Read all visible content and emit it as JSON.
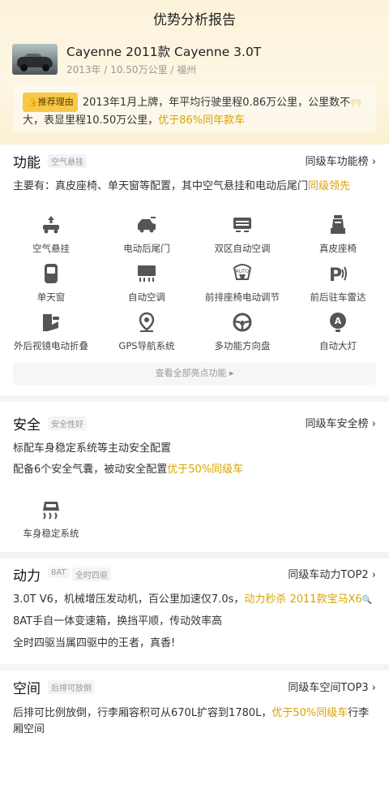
{
  "header": {
    "title": "优势分析报告",
    "car_name": "Cayenne 2011款 Cayenne 3.0T",
    "car_meta": "2013年 / 10.50万公里 / 福州",
    "reason_badge": "推荐理由",
    "reason_text_1": "2013年1月上牌，年平均行驶里程0.86万公里，公里数不大，表显里程10.50万公里，",
    "reason_highlight": "优于86%同年款车"
  },
  "function": {
    "title": "功能",
    "tag": "空气悬挂",
    "rank": "同级车功能榜",
    "desc_prefix": "主要有：真皮座椅、单天窗等配置，其中空气悬挂和电动后尾门",
    "desc_highlight": "同级领先",
    "features": [
      {
        "label": "空气悬挂",
        "icon": "air-suspension-icon"
      },
      {
        "label": "电动后尾门",
        "icon": "power-tailgate-icon"
      },
      {
        "label": "双区自动空调",
        "icon": "dual-zone-ac-icon"
      },
      {
        "label": "真皮座椅",
        "icon": "leather-seat-icon"
      },
      {
        "label": "单天窗",
        "icon": "sunroof-icon"
      },
      {
        "label": "自动空调",
        "icon": "auto-ac-icon"
      },
      {
        "label": "前排座椅电动调节",
        "icon": "power-seat-icon"
      },
      {
        "label": "前后驻车雷达",
        "icon": "parking-radar-icon"
      },
      {
        "label": "外后视镜电动折叠",
        "icon": "mirror-fold-icon"
      },
      {
        "label": "GPS导航系统",
        "icon": "gps-icon"
      },
      {
        "label": "多功能方向盘",
        "icon": "steering-wheel-icon"
      },
      {
        "label": "自动大灯",
        "icon": "auto-headlight-icon"
      }
    ],
    "more_label": "查看全部亮点功能 ▸"
  },
  "safety": {
    "title": "安全",
    "tag": "安全性好",
    "rank": "同级车安全榜",
    "line1": "标配车身稳定系统等主动安全配置",
    "line2_prefix": "配备6个安全气囊，被动安全配置",
    "line2_highlight": "优于50%同级车",
    "feature_label": "车身稳定系统",
    "feature_icon": "stability-control-icon"
  },
  "power": {
    "title": "动力",
    "tag1": "8AT",
    "tag2": "全时四驱",
    "rank": "同级车动力TOP2",
    "line1_prefix": "3.0T V6，机械增压发动机，百公里加速仅7.0s，",
    "line1_highlight": "动力秒杀 2011款宝马X6",
    "line2": "8AT手自一体变速箱，换挡平顺，传动效率高",
    "line3": "全时四驱当属四驱中的王者，真香!"
  },
  "space": {
    "title": "空间",
    "tag": "后排可放倒",
    "rank": "同级车空间TOP3",
    "line1_prefix": "后排可比例放倒，行李厢容积可从670L扩容到1780L，",
    "line1_highlight": "优于50%同级车",
    "line1_suffix": "行李",
    "line2": "厢空间"
  },
  "colors": {
    "accent": "#d9a300",
    "badge": "#f7c948",
    "bg_gradient": "#fbf3da"
  }
}
